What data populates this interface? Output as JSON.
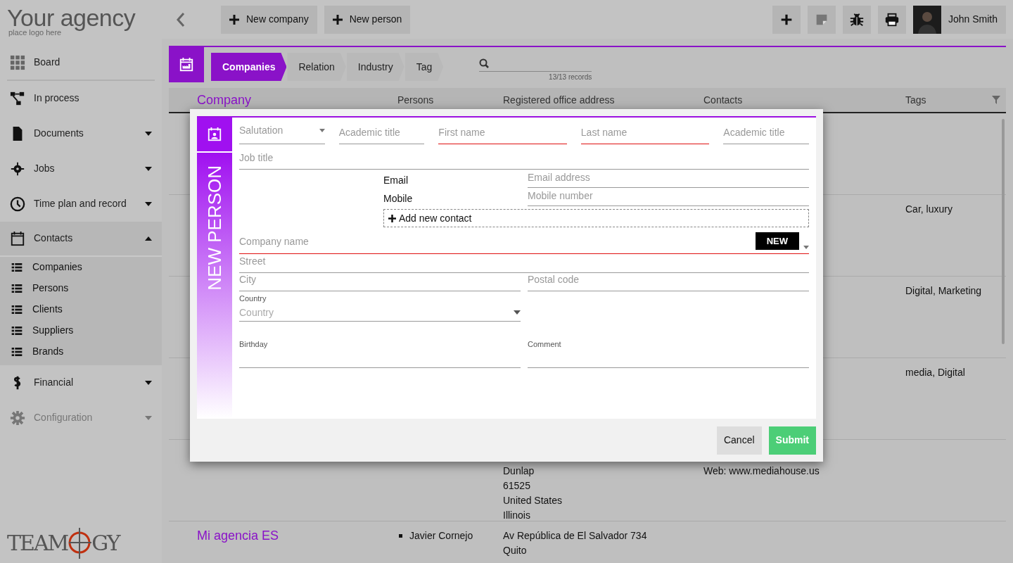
{
  "brand": {
    "title": "Your agency",
    "subtitle": "place logo here"
  },
  "toolbar": {
    "buttons": [
      {
        "label": "New company"
      },
      {
        "label": "New person"
      }
    ],
    "user": "John Smith"
  },
  "sidebar": {
    "items": [
      {
        "label": "Board",
        "kind": "link"
      },
      {
        "label": "In process",
        "kind": "link"
      },
      {
        "label": "Documents",
        "kind": "group",
        "expanded": false,
        "disabled": false
      },
      {
        "label": "Jobs",
        "kind": "group",
        "expanded": false,
        "disabled": false
      },
      {
        "label": "Time plan and record",
        "kind": "group",
        "expanded": false,
        "disabled": false
      },
      {
        "label": "Contacts",
        "kind": "group",
        "expanded": true,
        "disabled": false,
        "children": [
          {
            "label": "Companies"
          },
          {
            "label": "Persons"
          },
          {
            "label": "Clients"
          },
          {
            "label": "Suppliers"
          },
          {
            "label": "Brands"
          }
        ]
      },
      {
        "label": "Financial",
        "kind": "group",
        "expanded": false,
        "disabled": false
      },
      {
        "label": "Configuration",
        "kind": "group",
        "expanded": false,
        "disabled": true
      }
    ],
    "logo": {
      "left": "TEAM",
      "right": "GY"
    }
  },
  "breadcrumb": [
    {
      "label": "Companies",
      "selected": true
    },
    {
      "label": "Relation",
      "selected": false
    },
    {
      "label": "Industry",
      "selected": false
    },
    {
      "label": "Tag",
      "selected": false
    }
  ],
  "search": {
    "records": "13/13 records"
  },
  "table": {
    "columns": [
      "Company",
      "Persons",
      "Registered office address",
      "Contacts",
      "Tags"
    ],
    "rows": [
      {
        "company": "",
        "persons": [],
        "address": [],
        "contacts": [],
        "tags": ""
      },
      {
        "company": "",
        "persons": [],
        "address": [],
        "contacts": [],
        "tags": "Car, luxury"
      },
      {
        "company": "",
        "persons": [],
        "address": [],
        "contacts": [],
        "tags": "Digital, Marketing"
      },
      {
        "company": "",
        "persons": [],
        "address": [],
        "contacts": [],
        "tags": "media, Digital"
      },
      {
        "company": "",
        "persons": [],
        "address": [
          "Dunlap",
          "61525",
          "United States",
          "Illinois"
        ],
        "contacts": [
          "Web: www.mediahouse.us"
        ],
        "tags": ""
      },
      {
        "company": "Mi agencia ES",
        "persons": [
          "Javier Cornejo"
        ],
        "address": [
          "Av República de El Salvador 734",
          "Quito"
        ],
        "contacts": [],
        "tags": ""
      }
    ]
  },
  "modal": {
    "title": "NEW PERSON",
    "name_fields": [
      {
        "placeholder": "Salutation",
        "kind": "select",
        "required": false
      },
      {
        "placeholder": "Academic title",
        "kind": "text",
        "required": false
      },
      {
        "placeholder": "First name",
        "kind": "text",
        "required": true
      },
      {
        "placeholder": "Last name",
        "kind": "text",
        "required": true
      },
      {
        "placeholder": "Academic title",
        "kind": "text",
        "required": false
      }
    ],
    "job_title": {
      "placeholder": "Job title"
    },
    "contacts": [
      {
        "label": "Email",
        "placeholder": "Email address"
      },
      {
        "label": "Mobile",
        "placeholder": "Mobile number"
      }
    ],
    "add_contact": "Add new contact",
    "company": {
      "placeholder": "Company name",
      "required": true,
      "badge": "NEW"
    },
    "street": {
      "placeholder": "Street"
    },
    "city": {
      "placeholder": "City"
    },
    "postal": {
      "placeholder": "Postal code"
    },
    "country": {
      "label": "Country",
      "placeholder": "Country"
    },
    "birthday": {
      "label": "Birthday"
    },
    "comment": {
      "label": "Comment"
    },
    "buttons": [
      {
        "label": "Cancel",
        "kind": "secondary"
      },
      {
        "label": "Submit",
        "kind": "primary"
      }
    ]
  }
}
